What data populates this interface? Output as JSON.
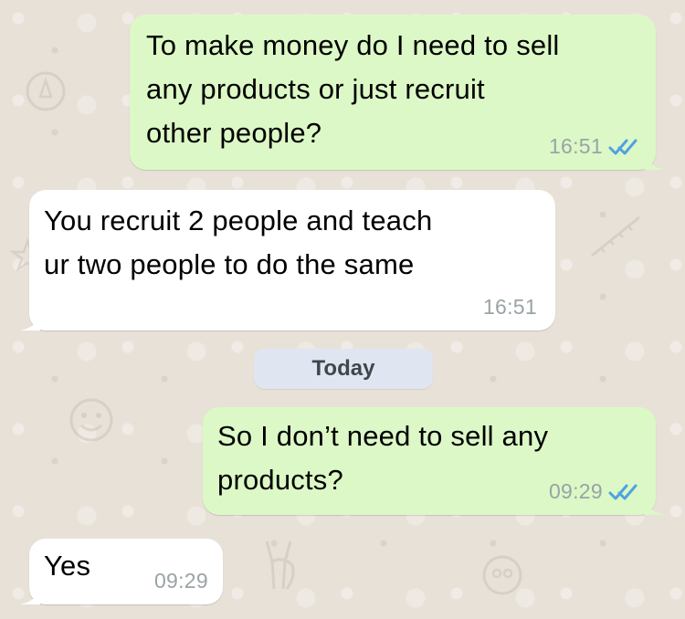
{
  "chat": {
    "messages": [
      {
        "direction": "outgoing",
        "text": "To make money do I need to sell any products or just recruit other people?",
        "lines": [
          "To make money do I need to sell",
          "any products or just recruit",
          "other people?"
        ],
        "time": "16:51",
        "status_icon": "double-check-read-icon"
      },
      {
        "direction": "incoming",
        "text": "You recruit 2 people and teach ur two people to do the same",
        "lines": [
          "You recruit 2 people and teach",
          "ur two people to do the same"
        ],
        "time": "16:51"
      },
      {
        "direction": "outgoing",
        "text": "So I don’t need to sell any products?",
        "lines": [
          "So I don’t need to sell any",
          "products?"
        ],
        "time": "09:29",
        "status_icon": "double-check-read-icon"
      },
      {
        "direction": "incoming",
        "text": "Yes",
        "lines": [
          "Yes"
        ],
        "time": "09:29"
      }
    ],
    "date_separator": "Today"
  },
  "colors": {
    "outgoing_bubble": "#dcf8c6",
    "incoming_bubble": "#ffffff",
    "wallpaper": "#e8e1d8",
    "read_ticks": "#4fa3e0",
    "timestamp": "#9aa3a6",
    "date_pill": "#dfe6f2"
  }
}
